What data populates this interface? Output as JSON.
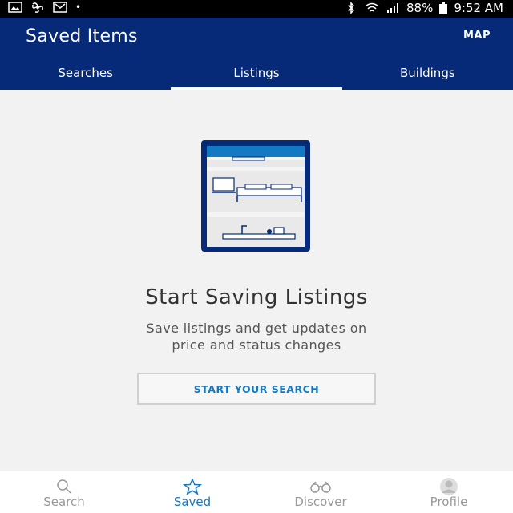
{
  "status_bar": {
    "battery": "88%",
    "time": "9:52 AM"
  },
  "header": {
    "title": "Saved Items",
    "map_label": "MAP"
  },
  "tabs": [
    {
      "label": "Searches",
      "active": false
    },
    {
      "label": "Listings",
      "active": true
    },
    {
      "label": "Buildings",
      "active": false
    }
  ],
  "empty_state": {
    "heading": "Start Saving Listings",
    "description_line1": "Save listings and get updates on",
    "description_line2": "price and status changes",
    "cta_label": "START YOUR SEARCH"
  },
  "bottom_nav": [
    {
      "label": "Search",
      "icon": "search-icon",
      "active": false
    },
    {
      "label": "Saved",
      "icon": "star-icon",
      "active": true
    },
    {
      "label": "Discover",
      "icon": "binoculars-icon",
      "active": false
    },
    {
      "label": "Profile",
      "icon": "avatar-icon",
      "active": false
    }
  ],
  "colors": {
    "header_bg": "#062a78",
    "accent": "#1479c3"
  }
}
